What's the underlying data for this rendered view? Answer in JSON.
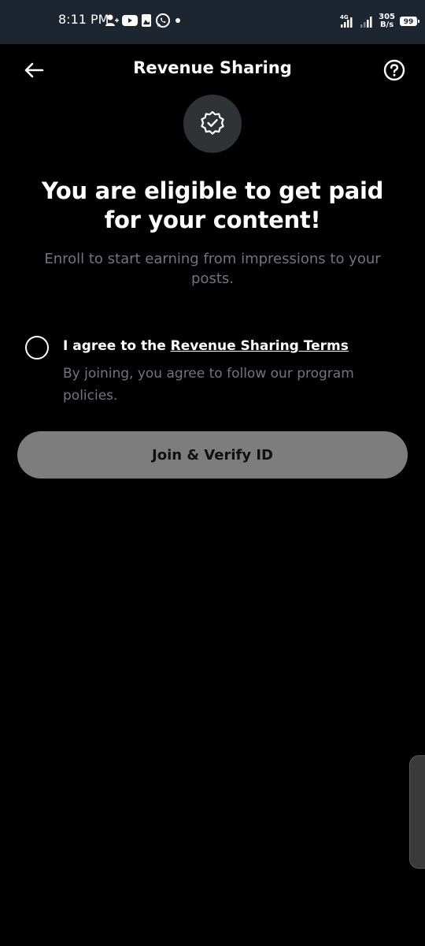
{
  "status_bar": {
    "time": "8:11 PM",
    "network_type": "4G",
    "net_speed_value": "305",
    "net_speed_unit": "B/s",
    "battery_level": "99"
  },
  "header": {
    "title": "Revenue Sharing"
  },
  "main": {
    "headline": "You are eligible to get paid for your content!",
    "subtext": "Enroll to start earning from impressions to your posts."
  },
  "agreement": {
    "label_prefix": "I agree to the",
    "terms_link": "Revenue Sharing Terms",
    "description": "By joining, you agree to follow our program policies."
  },
  "actions": {
    "join_label": "Join & Verify ID"
  },
  "colors": {
    "background": "#000000",
    "status_bar": "#1c2530",
    "secondary_text": "#71767b",
    "button_disabled": "#7d7d7d",
    "badge_background": "#2f3336"
  },
  "icons": {
    "back": "arrow-left-icon",
    "help": "question-circle-icon",
    "badge": "verified-badge-icon"
  }
}
